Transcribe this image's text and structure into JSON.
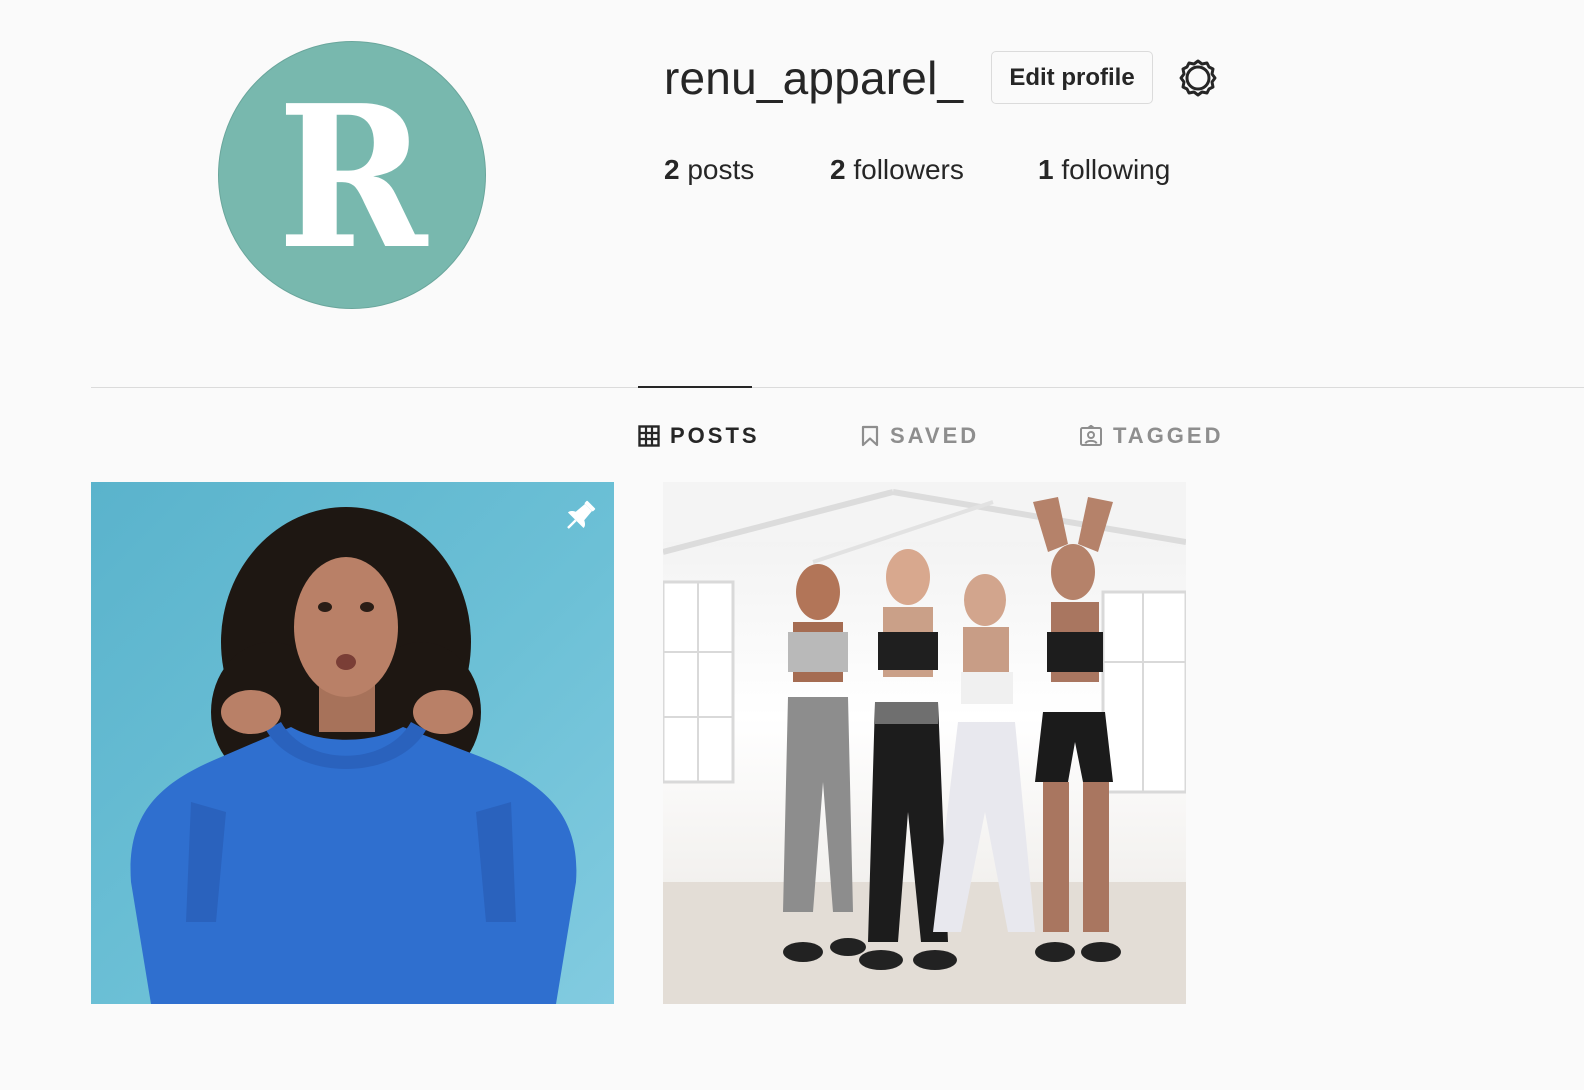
{
  "profile": {
    "avatar_letter": "R",
    "avatar_color": "#78b8ae",
    "username": "renu_apparel_",
    "edit_profile_label": "Edit profile",
    "settings_icon": "gear-icon"
  },
  "stats": {
    "posts_count": "2",
    "posts_label": "posts",
    "followers_count": "2",
    "followers_label": "followers",
    "following_count": "1",
    "following_label": "following"
  },
  "tabs": [
    {
      "label": "POSTS",
      "icon": "grid-icon",
      "active": true
    },
    {
      "label": "SAVED",
      "icon": "bookmark-icon",
      "active": false
    },
    {
      "label": "TAGGED",
      "icon": "tagged-user-icon",
      "active": false
    }
  ],
  "posts": [
    {
      "pinned": true,
      "pin_icon": "pin-icon"
    },
    {
      "pinned": false
    }
  ]
}
